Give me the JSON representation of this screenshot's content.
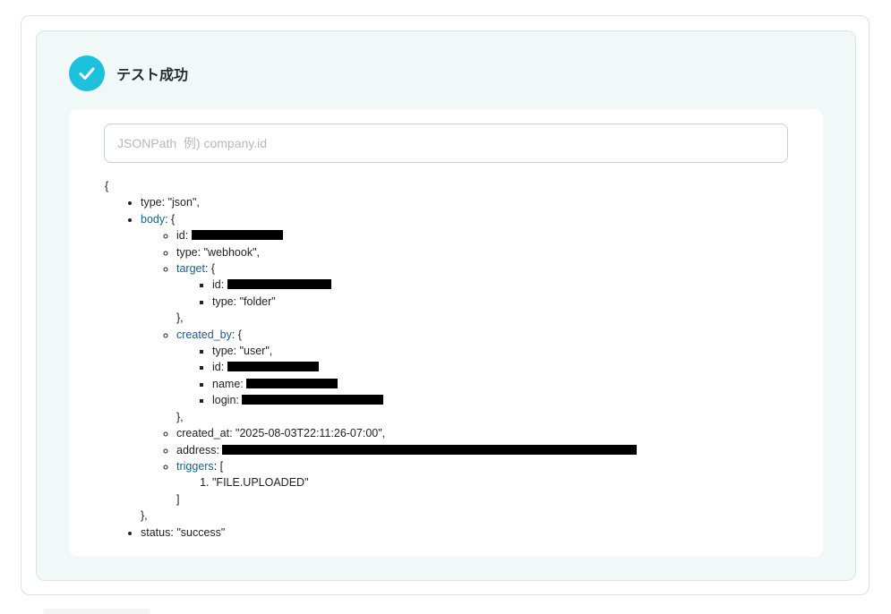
{
  "status": {
    "title": "テスト成功",
    "icon": "check-circle-icon",
    "accent": "#1ec1dd"
  },
  "search": {
    "placeholder": "JSONPath  例) company.id",
    "value": ""
  },
  "json": {
    "open": "{",
    "type_key": "type",
    "type_value": "\"json\",",
    "body_key": "body",
    "body_open": ": {",
    "body_id_key": "id:",
    "body_type_key": "type:",
    "body_type_value": "\"webhook\",",
    "target_key": "target",
    "target_open": ": {",
    "target_id_key": "id:",
    "target_type_key": "type:",
    "target_type_value": "\"folder\"",
    "target_close": "},",
    "created_by_key": "created_by",
    "created_by_open": ": {",
    "cb_type_key": "type:",
    "cb_type_value": "\"user\",",
    "cb_id_key": "id:",
    "cb_name_key": "name:",
    "cb_login_key": "login:",
    "created_by_close": "},",
    "created_at_key": "created_at:",
    "created_at_value": "\"2025-08-03T22:11:26-07:00\",",
    "address_key": "address:",
    "triggers_key": "triggers",
    "triggers_open": ": [",
    "trigger_1": "\"FILE.UPLOADED\"",
    "triggers_close": "]",
    "body_close": "},",
    "status_key": "status:",
    "status_value": "\"success\""
  }
}
